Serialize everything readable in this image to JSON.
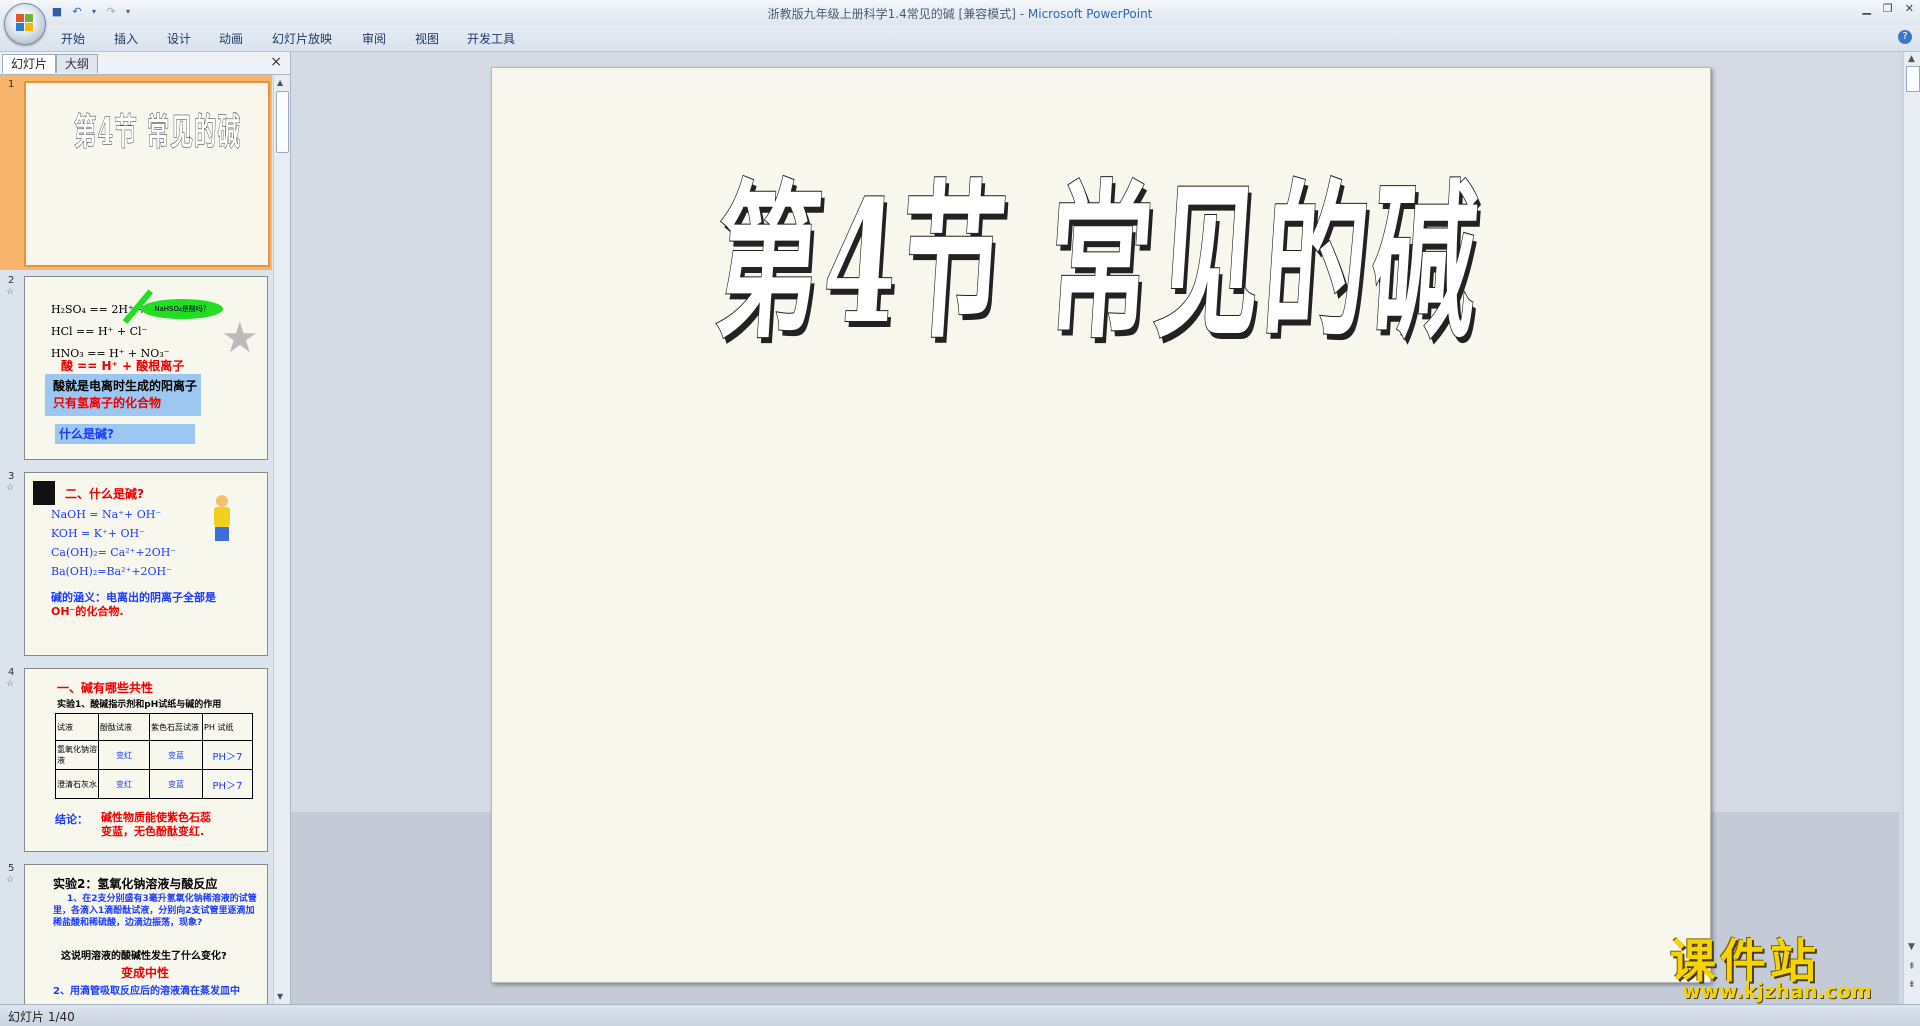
{
  "window": {
    "title": "浙教版九年级上册科学1.4常见的碱 [兼容模式] -",
    "app_name": "Microsoft PowerPoint"
  },
  "ribbon_tabs": [
    "开始",
    "插入",
    "设计",
    "动画",
    "幻灯片放映",
    "审阅",
    "视图",
    "开发工具"
  ],
  "panel": {
    "tab_slides": "幻灯片",
    "tab_outline": "大纲",
    "close_symbol": "×"
  },
  "thumbnails": {
    "s1": {
      "num": "1",
      "title": "第4节 常见的碱"
    },
    "s2": {
      "num": "2",
      "rows": [
        "H₂SO₄ == 2H⁺ + SO₄²⁻",
        "HCl == H⁺ + Cl⁻",
        "HNO₃ == H⁺ + NO₃⁻"
      ],
      "summary": "酸 == H⁺ + 酸根离子",
      "callout": "NaHSO₄是酸吗？",
      "def_line1": "酸就是电离时生成的阳离子",
      "def_line2": "只有氢离子的化合物",
      "question": "什么是碱?"
    },
    "s3": {
      "num": "3",
      "heading": "二、什么是碱?",
      "eq1": "NaOH = Na⁺+ OH⁻",
      "eq2": "KOH  = K⁺+ OH⁻",
      "eq3": "Ca(OH)₂= Ca²⁺+2OH⁻",
      "eq4": "Ba(OH)₂=Ba²⁺+2OH⁻",
      "def1": "碱的涵义：电离出的阴离子全部是",
      "def2": "OH⁻的化合物."
    },
    "s4": {
      "num": "4",
      "heading": "一、碱有哪些共性",
      "sub": "实验1、酸碱指示剂和pH试纸与碱的作用",
      "table_headers": [
        "试液",
        "酚酞试液",
        "紫色石蕊试液",
        "PH 试纸"
      ],
      "table_rows": [
        [
          "氢氧化钠溶液",
          "变红",
          "变蓝",
          "PH＞7"
        ],
        [
          "澄清石灰水",
          "变红",
          "变蓝",
          "PH＞7"
        ]
      ],
      "conclusion_label": "结论：",
      "conclusion1": "碱性物质能使紫色石蕊",
      "conclusion2": "变蓝，无色酚酞变红."
    },
    "s5": {
      "num": "5",
      "heading": "实验2：氢氧化钠溶液与酸反应",
      "body": "1、在2支分别盛有3毫升氢氧化钠稀溶液的试管里，各滴入1滴酚酞试液，分别向2支试管里逐滴加稀盐酸和稀硫酸，边滴边振荡，现象?",
      "question": "这说明溶液的酸碱性发生了什么变化?",
      "answer": "变成中性",
      "next": "2、用滴管吸取反应后的溶液滴在蒸发皿中"
    }
  },
  "main_slide": {
    "title": "第4节  常见的碱"
  },
  "status": {
    "slide_info": "幻灯片 1/40"
  },
  "watermark": {
    "big": "课件站",
    "small": "www.kjzhan.com"
  }
}
